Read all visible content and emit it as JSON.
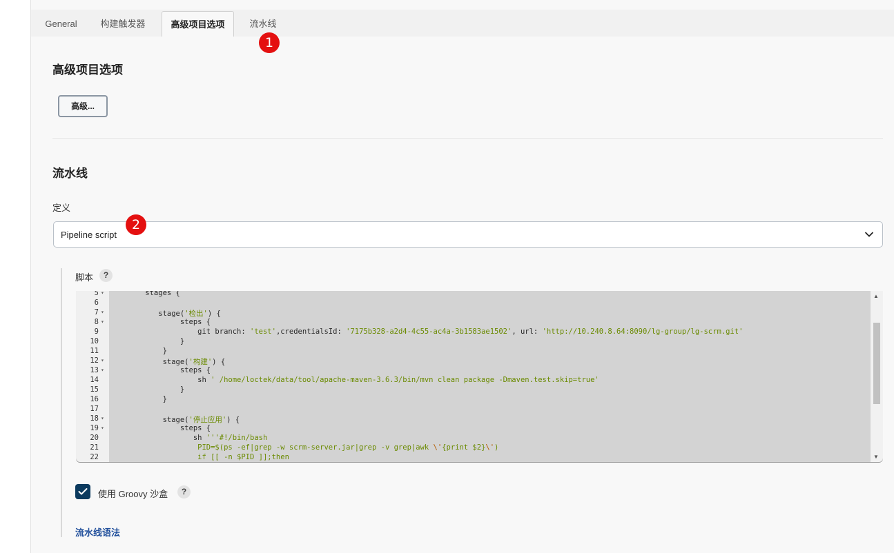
{
  "tabs": [
    {
      "label": "General",
      "active": false
    },
    {
      "label": "构建触发器",
      "active": false
    },
    {
      "label": "高级项目选项",
      "active": true
    },
    {
      "label": "流水线",
      "active": false
    }
  ],
  "badges": [
    "1",
    "2"
  ],
  "advanced_section": {
    "title": "高级项目选项",
    "button_label": "高级..."
  },
  "pipeline_section": {
    "title": "流水线",
    "definition_label": "定义",
    "definition_value": "Pipeline script",
    "script_label": "脚本",
    "help_glyph": "?",
    "sandbox_label": "使用 Groovy 沙盒",
    "sandbox_checked": true,
    "syntax_link": "流水线语法"
  },
  "script_lines": [
    {
      "n": "5",
      "fold": true,
      "text": "    stages {"
    },
    {
      "n": "6",
      "fold": false,
      "text": ""
    },
    {
      "n": "7",
      "fold": true,
      "text": "       stage('检出') {"
    },
    {
      "n": "8",
      "fold": true,
      "text": "            steps {"
    },
    {
      "n": "9",
      "fold": false,
      "text": "                git branch: 'test',credentialsId: '7175b328-a2d4-4c55-ac4a-3b1583ae1502', url: 'http://10.240.8.64:8090/lg-group/lg-scrm.git'"
    },
    {
      "n": "10",
      "fold": false,
      "text": "            }"
    },
    {
      "n": "11",
      "fold": false,
      "text": "        }"
    },
    {
      "n": "12",
      "fold": true,
      "text": "        stage('构建') {"
    },
    {
      "n": "13",
      "fold": true,
      "text": "            steps {"
    },
    {
      "n": "14",
      "fold": false,
      "text": "                sh ' /home/loctek/data/tool/apache-maven-3.6.3/bin/mvn clean package -Dmaven.test.skip=true'"
    },
    {
      "n": "15",
      "fold": false,
      "text": "            }"
    },
    {
      "n": "16",
      "fold": false,
      "text": "        }"
    },
    {
      "n": "17",
      "fold": false,
      "text": ""
    },
    {
      "n": "18",
      "fold": true,
      "text": "        stage('停止应用') {"
    },
    {
      "n": "19",
      "fold": true,
      "text": "            steps {"
    },
    {
      "n": "20",
      "fold": false,
      "text": "               sh '''#!/bin/bash"
    },
    {
      "n": "21",
      "fold": false,
      "text": "                PID=$(ps -ef|grep -w scrm-server.jar|grep -v grep|awk \\'{print $2}\\')"
    },
    {
      "n": "22",
      "fold": false,
      "text": "                if [[ -n $PID ]];then"
    }
  ],
  "colors": {
    "badge": "#e41010",
    "checkbox": "#0b3a5e",
    "link": "#1f4e9b",
    "editor_bg": "#d3d3d3",
    "string": "#6a8a00"
  }
}
